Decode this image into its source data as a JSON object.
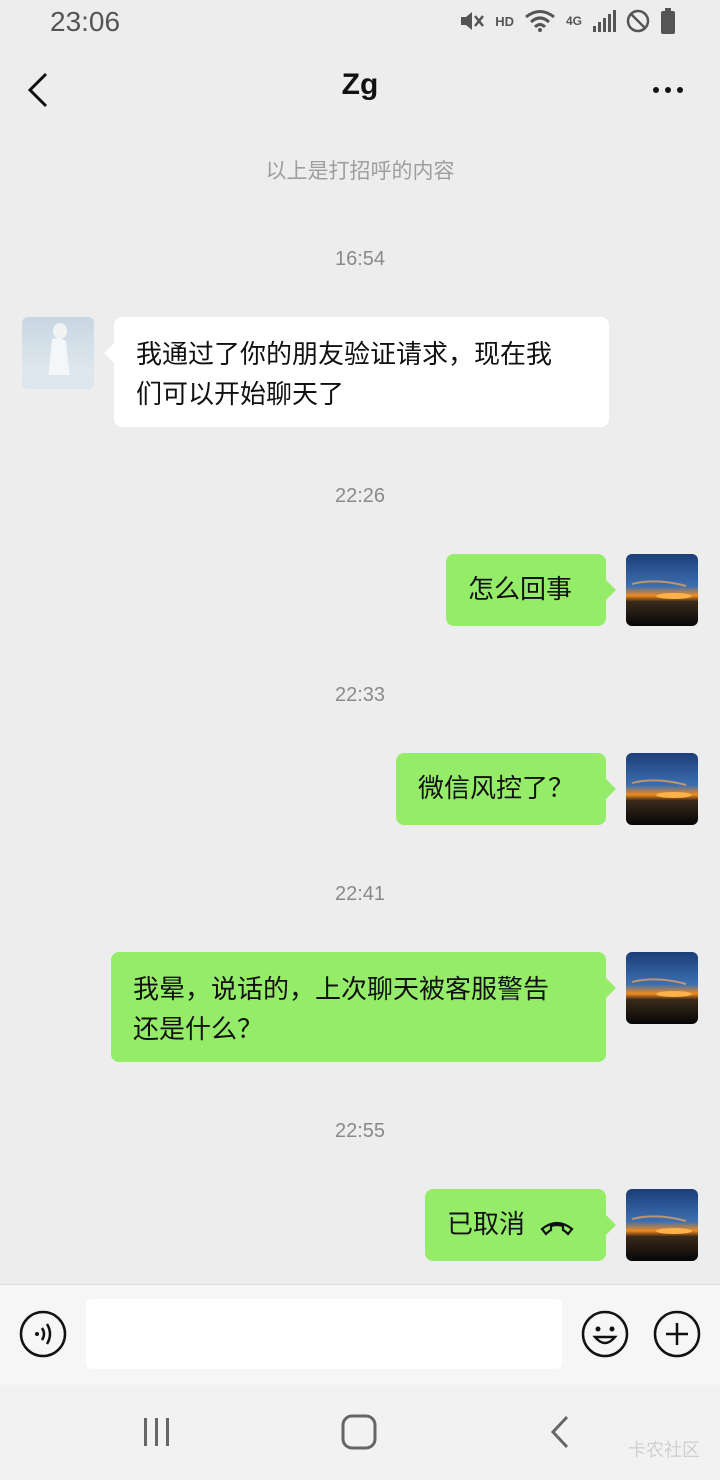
{
  "status": {
    "time": "23:06",
    "hd": "HD",
    "network": "4G"
  },
  "header": {
    "title": "Zg"
  },
  "chat": {
    "hint": "以上是打招呼的内容",
    "timestamps": [
      "16:54",
      "22:26",
      "22:33",
      "22:41",
      "22:55"
    ],
    "messages": [
      {
        "from": "contact",
        "text_lines": [
          "我通过了你的朋友验证请求，现在我",
          "们可以开始聊天了"
        ]
      },
      {
        "from": "me",
        "text": "怎么回事"
      },
      {
        "from": "me",
        "text": "微信风控了？"
      },
      {
        "from": "me",
        "text_lines": [
          "我晕，说话的，上次聊天被客服警告",
          "还是什么？"
        ]
      },
      {
        "from": "me",
        "text": "已取消",
        "icon": "phone-hangup-icon"
      }
    ]
  },
  "input": {
    "value": "",
    "placeholder": ""
  },
  "watermark": "卡农社区",
  "colors": {
    "background": "#ededed",
    "outgoing_bubble": "#95ec69",
    "incoming_bubble": "#ffffff"
  }
}
